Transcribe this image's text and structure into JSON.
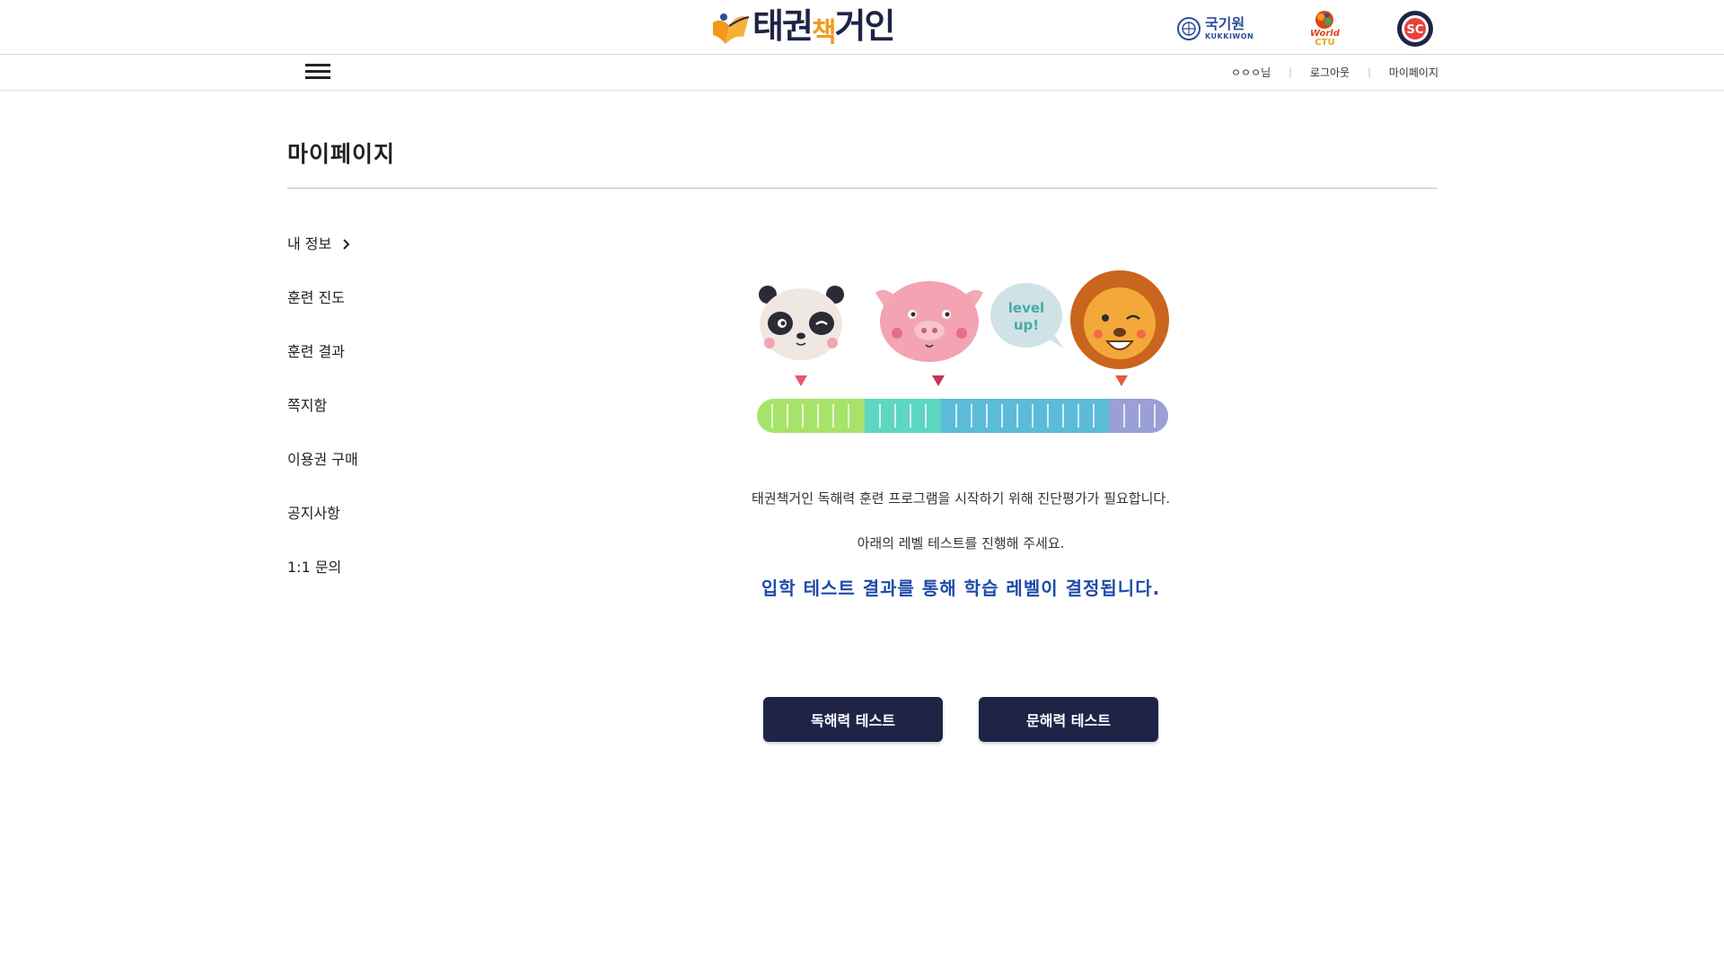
{
  "header": {
    "logo_text": "태권책거인",
    "logo_text_parts": [
      "태권",
      "책",
      "거인"
    ],
    "partners": [
      {
        "name": "kukkiwon",
        "label": "국기원",
        "sublabel": "KUKKIWON",
        "icon": "kukkiwon-logo"
      },
      {
        "name": "world-ctu",
        "label": "World",
        "sublabel": "CTU",
        "icon": "world-ctu-logo"
      },
      {
        "name": "sc",
        "label": "SC",
        "icon": "sc-emblem-logo"
      }
    ]
  },
  "nav": {
    "menu_icon": "hamburger-menu-icon",
    "user_name": "ㅇㅇㅇ님",
    "logout": "로그아웃",
    "mypage": "마이페이지",
    "separator": "|"
  },
  "page": {
    "title": "마이페이지"
  },
  "sidebar": {
    "items": [
      {
        "label": "내 정보",
        "active": true,
        "icon": "chevron-right-icon"
      },
      {
        "label": "훈련 진도"
      },
      {
        "label": "훈련 결과"
      },
      {
        "label": "쪽지함"
      },
      {
        "label": "이용권 구매"
      },
      {
        "label": "공지사항"
      },
      {
        "label": "1:1 문의"
      }
    ]
  },
  "main": {
    "illustration": {
      "characters": [
        "panda-icon",
        "pig-icon",
        "lion-icon"
      ],
      "bubble_text": [
        "level",
        "up!"
      ],
      "bar_colors": [
        "#a6e36a",
        "#5fd6c2",
        "#5bbcd8",
        "#9a9fd6"
      ]
    },
    "message_line1": "태권책거인 독해력 훈련 프로그램을 시작하기 위해 진단평가가 필요합니다.",
    "message_line2": "아래의 레벨 테스트를 진행해 주세요.",
    "message_highlight": "입학 테스트 결과를 통해 학습 레벨이 결정됩니다.",
    "buttons": {
      "reading_test": "독해력 테스트",
      "literacy_test": "문해력 테스트"
    }
  },
  "colors": {
    "brand_navy": "#1f2447",
    "brand_orange": "#f29a1e",
    "highlight_blue": "#1f4aa8"
  }
}
